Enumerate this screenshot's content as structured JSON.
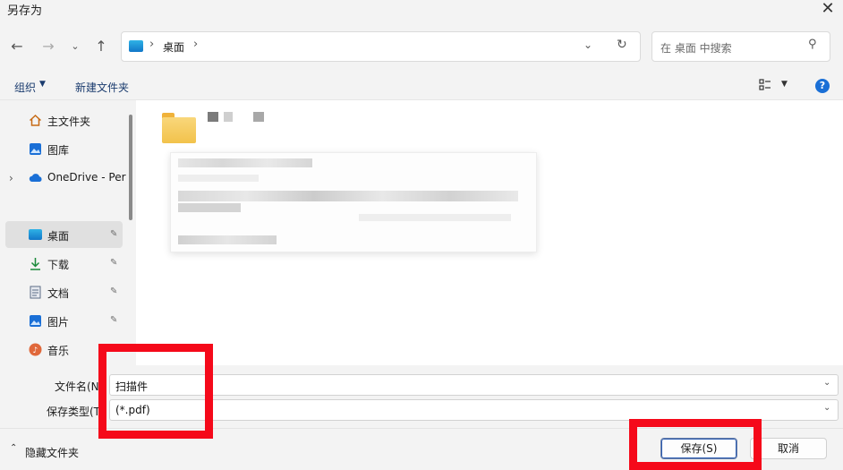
{
  "window": {
    "title": "另存为"
  },
  "address": {
    "location": "桌面",
    "separator": "›"
  },
  "search": {
    "placeholder": "在 桌面 中搜索"
  },
  "toolbar": {
    "organize": "组织",
    "new_folder": "新建文件夹"
  },
  "sidebar": {
    "items": [
      {
        "label": "主文件夹",
        "icon": "home-icon"
      },
      {
        "label": "图库",
        "icon": "gallery-icon"
      },
      {
        "label": "OneDrive - Per",
        "icon": "cloud-icon"
      },
      {
        "label": "桌面",
        "icon": "desktop-icon",
        "selected": true,
        "pinned": true
      },
      {
        "label": "下载",
        "icon": "download-icon",
        "pinned": true
      },
      {
        "label": "文档",
        "icon": "document-icon",
        "pinned": true
      },
      {
        "label": "图片",
        "icon": "pictures-icon",
        "pinned": true
      },
      {
        "label": "音乐",
        "icon": "music-icon"
      }
    ]
  },
  "form": {
    "filename_label": "文件名(N",
    "filename_value": "扫描件",
    "filetype_label": "保存类型(T",
    "filetype_value": "(*.pdf)"
  },
  "footer": {
    "hide_folders": "隐藏文件夹"
  },
  "buttons": {
    "save": "保存(S)",
    "cancel": "取消"
  },
  "colors": {
    "highlight_red": "#f5091a",
    "accent_blue": "#1a6fd6"
  }
}
